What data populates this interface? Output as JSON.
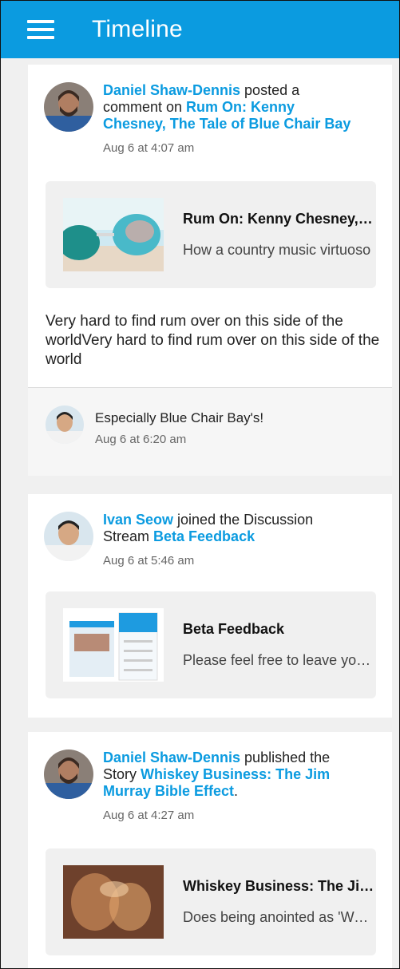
{
  "header": {
    "title": "Timeline"
  },
  "posts": [
    {
      "author": "Daniel Shaw-Dennis",
      "action": " posted a comment on ",
      "target": "Rum On: Kenny Chesney, The Tale of Blue Chair Bay",
      "time": "Aug 6 at 4:07 am",
      "preview": {
        "title": "Rum On: Kenny Chesney, The Tale of Blue Chair Bay",
        "desc": "How a country music virtuoso"
      },
      "body": "Very hard to find rum over on this side of the worldVery hard to find rum over on this side of the world",
      "reply": {
        "text": "Especially Blue Chair Bay's!",
        "time": "Aug 6 at 6:20 am"
      }
    },
    {
      "author": "Ivan Seow",
      "action": " joined the Discussion Stream ",
      "target": "Beta Feedback",
      "time": "Aug 6 at 5:46 am",
      "preview": {
        "title": "Beta Feedback",
        "desc": "Please feel free to leave your feedback"
      }
    },
    {
      "author": "Daniel Shaw-Dennis",
      "action": " published the Story ",
      "target": "Whiskey Business: The Jim Murray Bible Effect",
      "suffix": ".",
      "time": "Aug 6 at 4:27 am",
      "preview": {
        "title": "Whiskey Business: The Jim Murray Bible Effect",
        "desc": "Does being anointed as 'World"
      }
    }
  ],
  "colors": {
    "accent": "#0b9be0",
    "background": "#f0f0f0"
  }
}
